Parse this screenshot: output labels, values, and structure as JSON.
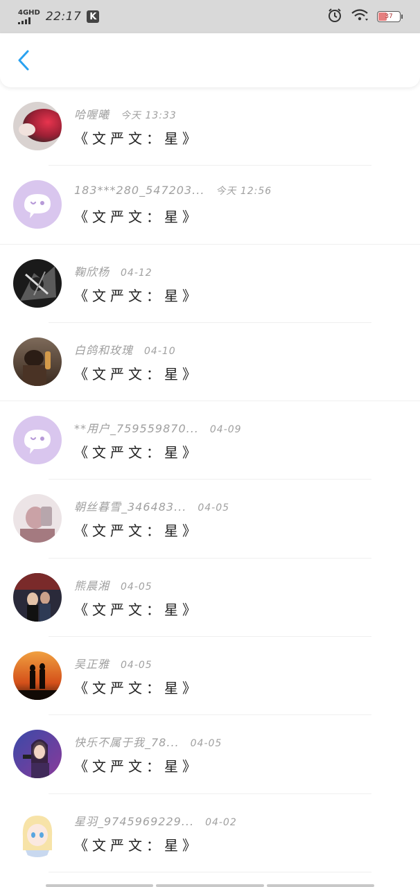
{
  "status_bar": {
    "network": "4GHD",
    "time": "22:17",
    "app_badge": "K",
    "battery": "37",
    "icons": [
      "alarm-icon",
      "wifi-icon",
      "battery-icon"
    ]
  },
  "header": {
    "back_icon": "chevron-left-icon",
    "accent_color": "#2aa2f0"
  },
  "list": [
    {
      "name": "哈喔曦",
      "time": "今天 13:33",
      "message": "《文严文：星》",
      "avatar": "photo"
    },
    {
      "name": "183***280_547203...",
      "time": "今天 12:56",
      "message": "《文严文：星》",
      "avatar": "default-bubble"
    },
    {
      "name": "鞠欣杨",
      "time": "04-12",
      "message": "《文严文：星》",
      "avatar": "photo"
    },
    {
      "name": "白鸽和玫瑰",
      "time": "04-10",
      "message": "《文严文：星》",
      "avatar": "photo"
    },
    {
      "name": "**用户_759559870...",
      "time": "04-09",
      "message": "《文严文：星》",
      "avatar": "default-bubble"
    },
    {
      "name": "朝丝暮雪_346483...",
      "time": "04-05",
      "message": "《文严文：星》",
      "avatar": "photo"
    },
    {
      "name": "熊晨湘",
      "time": "04-05",
      "message": "《文严文：星》",
      "avatar": "photo"
    },
    {
      "name": "吴正雅",
      "time": "04-05",
      "message": "《文严文：星》",
      "avatar": "photo"
    },
    {
      "name": "快乐不属于我_78...",
      "time": "04-05",
      "message": "《文严文：星》",
      "avatar": "photo"
    },
    {
      "name": "星羽_9745969229...",
      "time": "04-02",
      "message": "《文严文：星》",
      "avatar": "photo"
    }
  ]
}
